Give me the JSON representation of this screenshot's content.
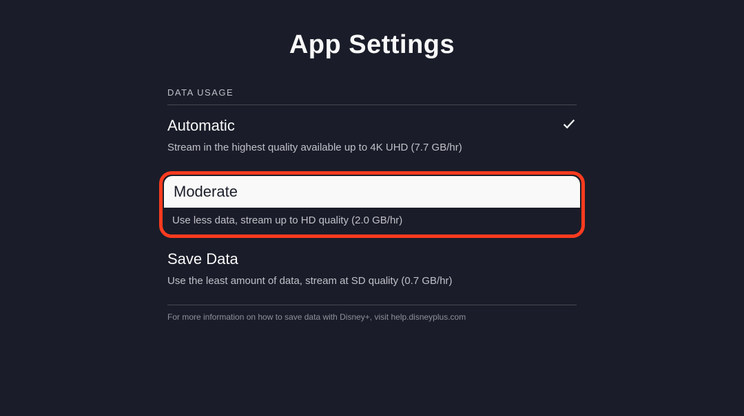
{
  "page": {
    "title": "App Settings"
  },
  "section": {
    "header": "DATA USAGE",
    "options": [
      {
        "title": "Automatic",
        "description": "Stream in the highest quality available up to 4K UHD (7.7 GB/hr)",
        "selected": true
      },
      {
        "title": "Moderate",
        "description": "Use less data, stream up to HD quality (2.0 GB/hr)",
        "highlighted": true
      },
      {
        "title": "Save Data",
        "description": "Use the least amount of data, stream at SD quality (0.7 GB/hr)"
      }
    ],
    "footer": "For more information on how to save data with Disney+, visit help.disneyplus.com"
  }
}
